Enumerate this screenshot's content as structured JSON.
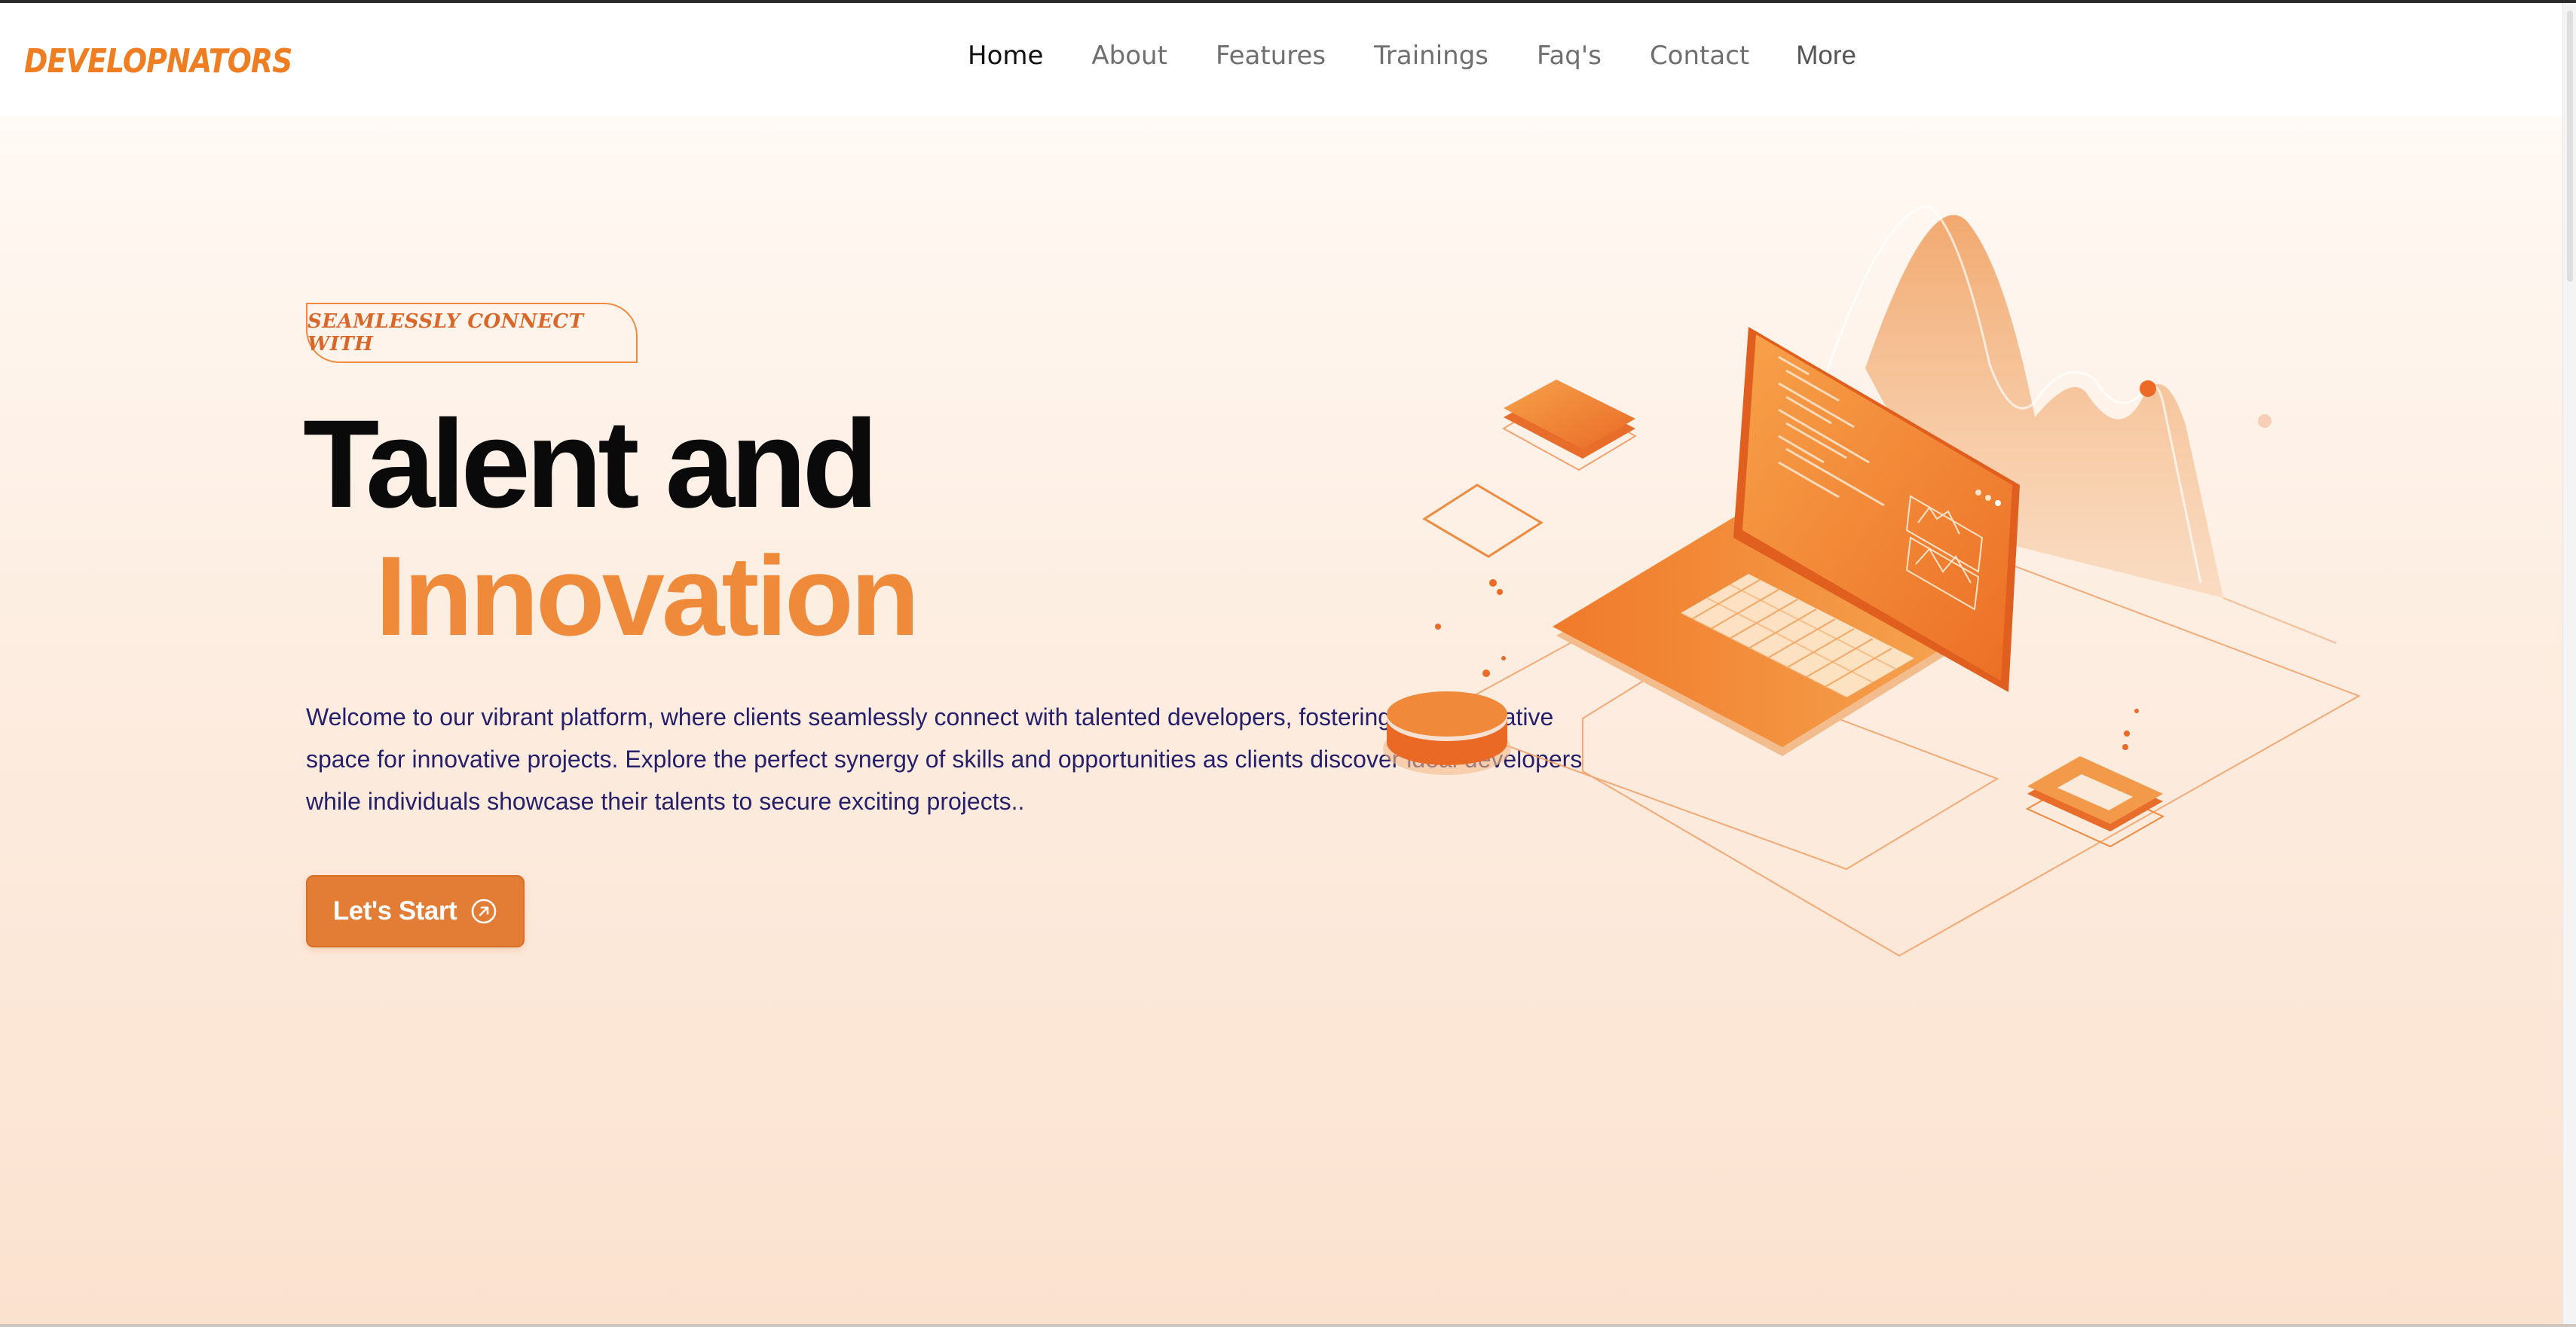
{
  "brand": {
    "logo": "DEVELOPNATORS"
  },
  "nav": {
    "items": [
      {
        "label": "Home",
        "active": true
      },
      {
        "label": "About"
      },
      {
        "label": "Features"
      },
      {
        "label": "Trainings"
      },
      {
        "label": "Faq's"
      },
      {
        "label": "Contact"
      },
      {
        "label": "More"
      }
    ]
  },
  "hero": {
    "tagline": "SEAMLESSLY CONNECT WITH",
    "title_line1": "Talent and",
    "title_line2": "Innovation",
    "description": "Welcome to our vibrant platform, where clients seamlessly connect with talented developers, fostering a collaborative space for innovative projects. Explore the perfect synergy of skills and opportunities as clients discover ideal developers while individuals showcase their talents to secure exciting projects..",
    "cta_label": "Let's Start",
    "cta_icon": "arrow-up-right-circle-icon"
  },
  "illustration": {
    "name": "isometric-laptop-analytics"
  },
  "colors": {
    "accent": "#ef8a3a",
    "accent_dark": "#e37d36",
    "heading": "#0a0a0a",
    "body_text": "#26206b",
    "nav_text": "#6f6f6f"
  }
}
